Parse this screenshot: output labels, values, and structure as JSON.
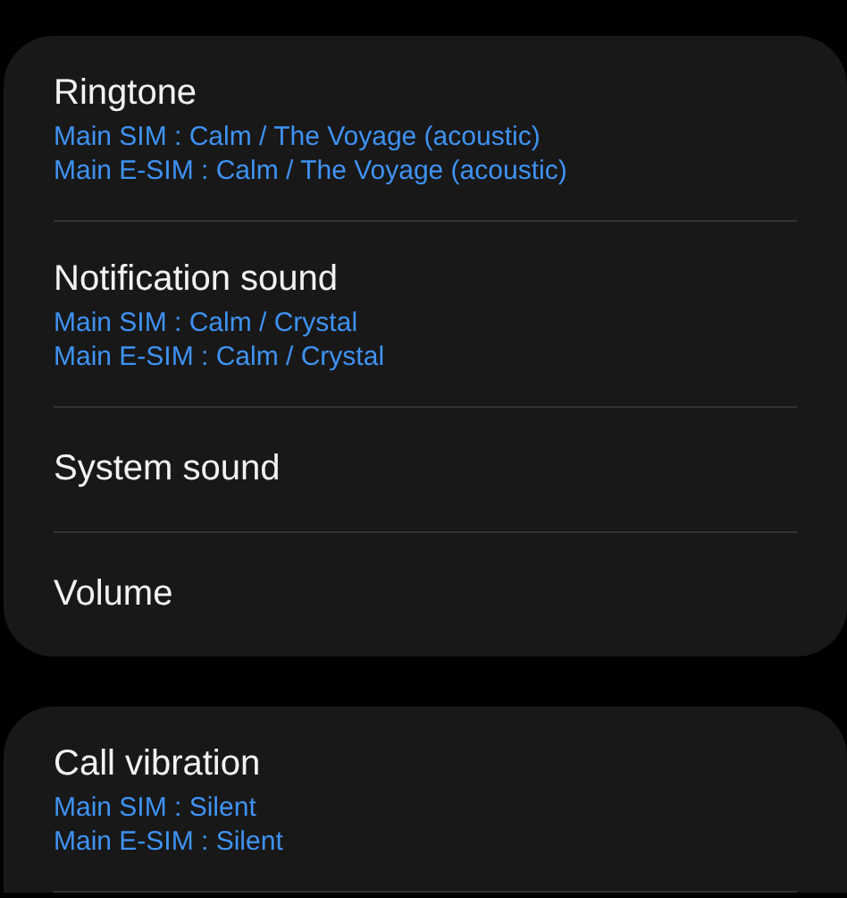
{
  "cards": [
    {
      "continues": false,
      "items": [
        {
          "title": "Ringtone",
          "details": [
            "Main SIM : Calm / The Voyage (acoustic)",
            "Main E-SIM : Calm / The Voyage (acoustic)"
          ]
        },
        {
          "title": "Notification sound",
          "details": [
            "Main SIM : Calm / Crystal",
            "Main E-SIM : Calm / Crystal"
          ]
        },
        {
          "title": "System sound"
        },
        {
          "title": "Volume"
        }
      ]
    },
    {
      "continues": true,
      "items": [
        {
          "title": "Call vibration",
          "details": [
            "Main SIM : Silent",
            "Main E-SIM : Silent"
          ]
        }
      ]
    }
  ]
}
